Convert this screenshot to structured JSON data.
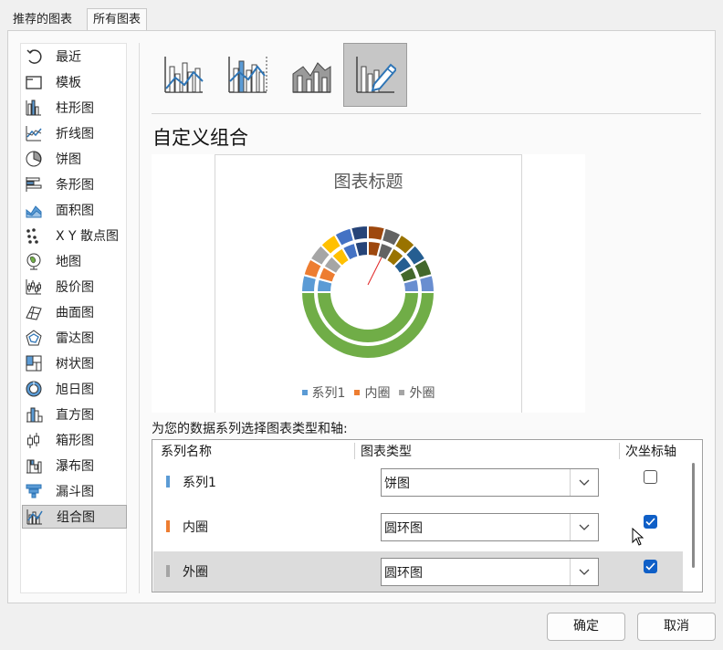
{
  "tabs": {
    "recommended": "推荐的图表",
    "all": "所有图表"
  },
  "nav": {
    "items": [
      {
        "label": "最近",
        "icon": "recent-icon"
      },
      {
        "label": "模板",
        "icon": "template-icon"
      },
      {
        "label": "柱形图",
        "icon": "column-chart-icon"
      },
      {
        "label": "折线图",
        "icon": "line-chart-icon"
      },
      {
        "label": "饼图",
        "icon": "pie-chart-icon"
      },
      {
        "label": "条形图",
        "icon": "bar-chart-icon"
      },
      {
        "label": "面积图",
        "icon": "area-chart-icon"
      },
      {
        "label": "X Y 散点图",
        "icon": "scatter-chart-icon"
      },
      {
        "label": "地图",
        "icon": "map-chart-icon"
      },
      {
        "label": "股价图",
        "icon": "stock-chart-icon"
      },
      {
        "label": "曲面图",
        "icon": "surface-chart-icon"
      },
      {
        "label": "雷达图",
        "icon": "radar-chart-icon"
      },
      {
        "label": "树状图",
        "icon": "treemap-chart-icon"
      },
      {
        "label": "旭日图",
        "icon": "sunburst-chart-icon"
      },
      {
        "label": "直方图",
        "icon": "histogram-chart-icon"
      },
      {
        "label": "箱形图",
        "icon": "box-whisker-chart-icon"
      },
      {
        "label": "瀑布图",
        "icon": "waterfall-chart-icon"
      },
      {
        "label": "漏斗图",
        "icon": "funnel-chart-icon"
      },
      {
        "label": "组合图",
        "icon": "combo-chart-icon"
      }
    ],
    "selected": "组合图"
  },
  "combo_types": [
    {
      "icon": "clustered-column-line-icon"
    },
    {
      "icon": "clustered-column-line-secondary-axis-icon"
    },
    {
      "icon": "stacked-area-clustered-column-icon"
    },
    {
      "icon": "custom-combination-icon",
      "selected": true
    }
  ],
  "section_title": "自定义组合",
  "preview": {
    "title": "图表标题",
    "legend": [
      {
        "name": "系列1",
        "color": "#5b9bd5"
      },
      {
        "name": "内圈",
        "color": "#ed7d31"
      },
      {
        "name": "外圈",
        "color": "#a5a5a5"
      }
    ]
  },
  "chart_data": {
    "type": "donut",
    "title": "图表标题",
    "series": [
      {
        "name": "系列1",
        "chart": "饼图"
      },
      {
        "name": "内圈",
        "chart": "圆环图",
        "values": [
          1,
          1,
          1,
          1,
          1,
          1,
          1,
          1,
          1,
          1,
          1,
          1,
          12
        ]
      },
      {
        "name": "外圈",
        "chart": "圆环图",
        "values": [
          1,
          1,
          1,
          1,
          1,
          1,
          1,
          1,
          1,
          1,
          1,
          1,
          12
        ]
      }
    ],
    "colors": [
      "#5b9bd5",
      "#ed7d31",
      "#a5a5a5",
      "#ffc000",
      "#4472c4",
      "#264478",
      "#9e480e",
      "#636363",
      "#997300",
      "#255e91",
      "#43682b",
      "#698ed0",
      "#70ad47"
    ]
  },
  "instruction": "为您的数据系列选择图表类型和轴:",
  "table": {
    "headers": {
      "name": "系列名称",
      "type": "图表类型",
      "axis": "次坐标轴"
    },
    "rows": [
      {
        "name": "系列1",
        "type": "饼图",
        "secondary": false,
        "color": "#5b9bd5"
      },
      {
        "name": "内圈",
        "type": "圆环图",
        "secondary": true,
        "color": "#ed7d31"
      },
      {
        "name": "外圈",
        "type": "圆环图",
        "secondary": true,
        "color": "#a5a5a5"
      }
    ]
  },
  "buttons": {
    "ok": "确定",
    "cancel": "取消"
  }
}
